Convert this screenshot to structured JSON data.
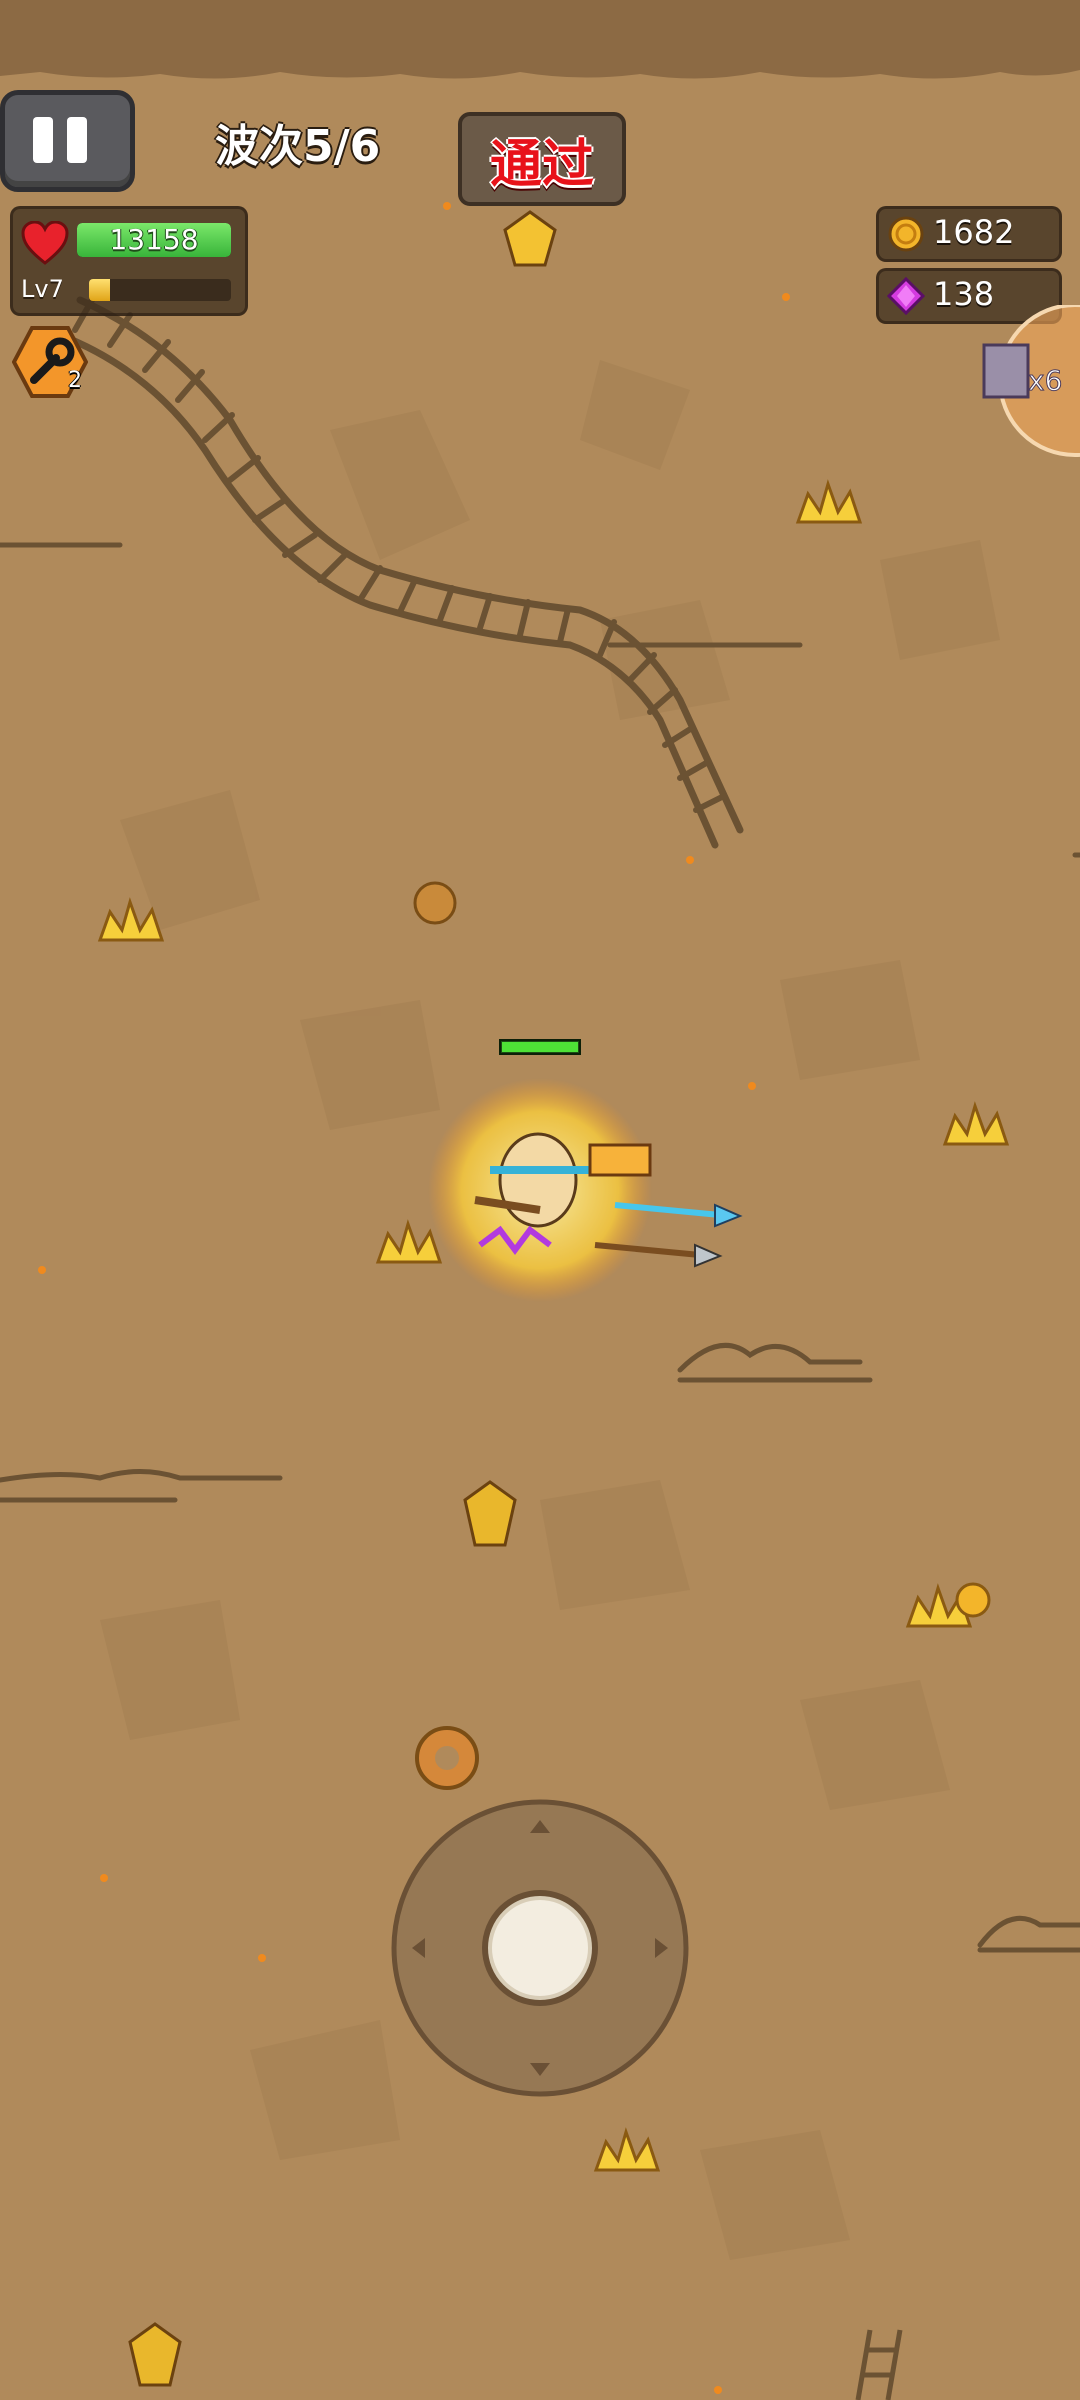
{
  "hud": {
    "wave_label": "波次5/6",
    "pass_button": "通过",
    "hp_value": "13158",
    "hp_fraction": 1.0,
    "level_label": "Lv7",
    "xp_fraction": 0.15,
    "skill_count": "2",
    "gold": "1682",
    "gems": "138",
    "bonus_multiplier": "x6"
  },
  "player": {
    "health_fraction": 1.0
  },
  "colors": {
    "ground": "#b08a5b",
    "hp_green": "#4cc043",
    "pass_red": "#e8121a",
    "gem_purple": "#d43be0",
    "gold": "#f3b52a"
  },
  "icons": {
    "pause": "pause-icon",
    "heart": "heart-icon",
    "skill": "wrench-skill-icon",
    "coin": "coin-icon",
    "gem": "gem-icon",
    "joystick": "joystick"
  }
}
